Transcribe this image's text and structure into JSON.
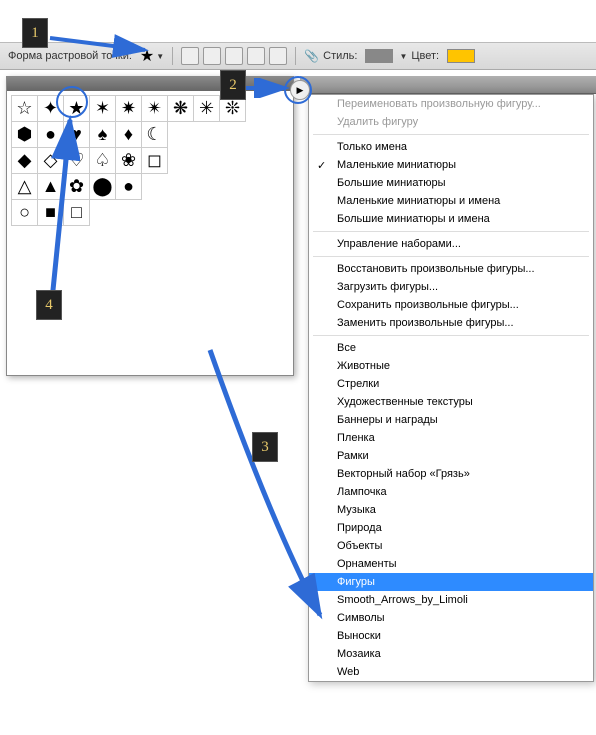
{
  "toolbar": {
    "label_shape": "Форма растровой точки:",
    "label_style": "Стиль:",
    "label_color": "Цвет:",
    "color_value": "#ffc400"
  },
  "badges": {
    "n1": "1",
    "n2": "2",
    "n3": "3",
    "n4": "4"
  },
  "shapes_grid": [
    [
      "☆",
      "✦",
      "★",
      "✶",
      "✷",
      "✴",
      "❋",
      "✳",
      "❊"
    ],
    [
      "⬢",
      "●",
      "♥",
      "♠",
      "♦",
      "☾",
      "",
      "",
      ""
    ],
    [
      "◆",
      "◇",
      "♡",
      "♤",
      "❀",
      "◻",
      "",
      "",
      ""
    ],
    [
      "△",
      "▲",
      "✿",
      "⬤",
      "●",
      "",
      "",
      "",
      ""
    ],
    [
      "○",
      "■",
      "□",
      "",
      "",
      "",
      "",
      "",
      ""
    ]
  ],
  "menu": {
    "rename": "Переименовать произвольную фигуру...",
    "delete": "Удалить фигуру",
    "names_only": "Только имена",
    "small_thumb": "Маленькие миниатюры",
    "large_thumb": "Большие миниатюры",
    "small_thumb_names": "Маленькие миниатюры и имена",
    "large_thumb_names": "Большие миниатюры и имена",
    "manage": "Управление наборами...",
    "restore": "Восстановить произвольные фигуры...",
    "load": "Загрузить фигуры...",
    "save": "Сохранить произвольные фигуры...",
    "replace": "Заменить произвольные фигуры...",
    "sets": [
      "Все",
      "Животные",
      "Стрелки",
      "Художественные текстуры",
      "Баннеры и награды",
      "Пленка",
      "Рамки",
      "Векторный набор «Грязь»",
      "Лампочка",
      "Музыка",
      "Природа",
      "Объекты",
      "Орнаменты",
      "Фигуры",
      "Smooth_Arrows_by_Limoli",
      "Символы",
      "Выноски",
      "Мозаика",
      "Web"
    ],
    "highlighted_index": 13
  }
}
